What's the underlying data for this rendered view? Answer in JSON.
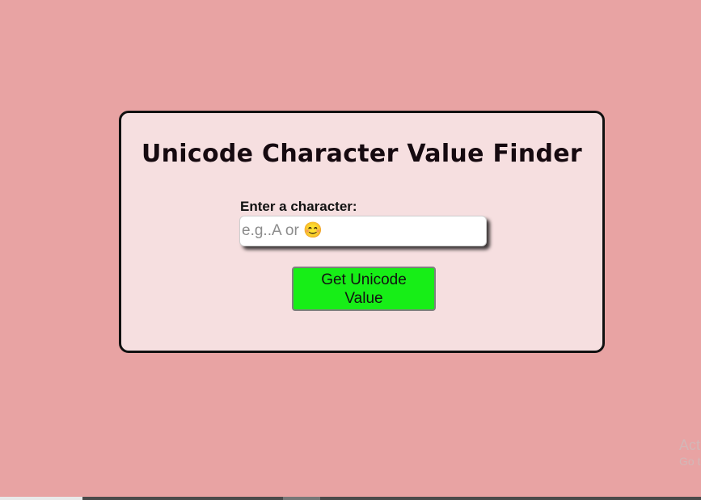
{
  "page": {
    "title": "Unicode Character Value Finder"
  },
  "form": {
    "label": "Enter a character:",
    "input_value": "",
    "input_placeholder": "e.g..A or 😊",
    "button_label": "Get Unicode Value"
  },
  "watermark": {
    "line1": "Act",
    "line2": "Go t"
  },
  "colors": {
    "page_background": "#e8a3a3",
    "card_background": "#f6dfe0",
    "button_background": "#17ee17"
  }
}
